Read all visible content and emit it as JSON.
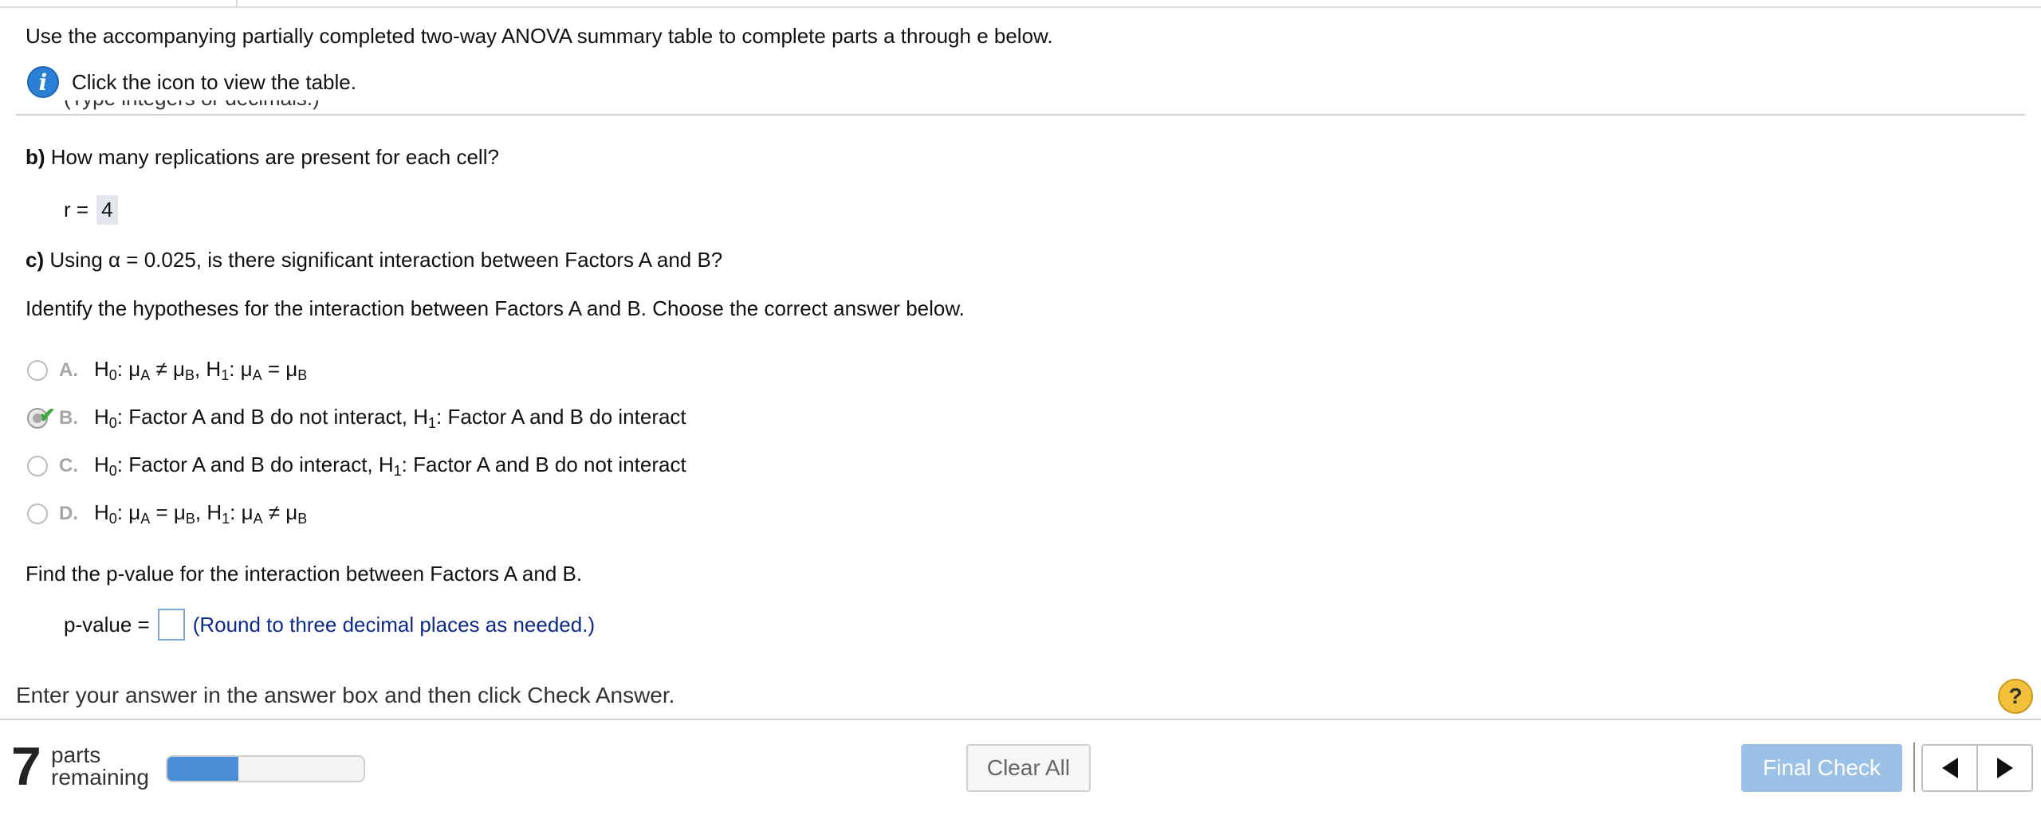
{
  "intro": "Use the accompanying partially completed two-way ANOVA summary table to complete parts a through e below.",
  "info": {
    "icon": "info-icon",
    "text": "Click the icon to view the table."
  },
  "cut_text": "(Type integers or decimals.)",
  "part_b": {
    "label": "b)",
    "question": "How many replications are present for each cell?",
    "r_label": "r =",
    "r_value": "4"
  },
  "part_c": {
    "label": "c)",
    "question": "Using α = 0.025, is there significant interaction between Factors A and B?",
    "hyp_prompt": "Identify the hypotheses for the interaction between Factors A and B. Choose the correct answer below.",
    "options": [
      {
        "letter": "A.",
        "h0": "H",
        "h0_sub": "0",
        "h0_rest": ": μ",
        "a": "A",
        "op1": " ≠ μ",
        "b": "B",
        "h1": ", H",
        "h1_sub": "1",
        "h1_rest": ": μ",
        "a2": "A",
        "op2": " = μ",
        "b2": "B"
      },
      {
        "letter": "B.",
        "selected": true,
        "h0": "H",
        "h0_sub": "0",
        "h0_text": ": Factor A and B do not interact, H",
        "h1_sub": "1",
        "h1_text": ": Factor A and B do interact"
      },
      {
        "letter": "C.",
        "h0": "H",
        "h0_sub": "0",
        "h0_text": ": Factor A and B do interact, H",
        "h1_sub": "1",
        "h1_text": ": Factor A and B do not interact"
      },
      {
        "letter": "D.",
        "h0": "H",
        "h0_sub": "0",
        "h0_rest": ": μ",
        "a": "A",
        "op1": " = μ",
        "b": "B",
        "h1": ", H",
        "h1_sub": "1",
        "h1_rest": ": μ",
        "a2": "A",
        "op2": " ≠ μ",
        "b2": "B"
      }
    ],
    "pvalue_prompt": "Find the p-value for the interaction between Factors A and B.",
    "pvalue_label": "p-value =",
    "pvalue_input": "",
    "pvalue_hint": "(Round to three decimal places as needed.)"
  },
  "instruction": "Enter your answer in the answer box and then click Check Answer.",
  "help_label": "?",
  "footer": {
    "parts_count": "7",
    "parts_label_1": "parts",
    "parts_label_2": "remaining",
    "progress_fraction": 0.36,
    "clear_label": "Clear All",
    "final_label": "Final Check",
    "prev_icon": "triangle-left-icon",
    "next_icon": "triangle-right-icon"
  },
  "colors": {
    "accent": "#2b7fd4",
    "final_button": "#9bc2e6",
    "hint": "#0d2a8a",
    "check": "#3aa73a",
    "help": "#f2c03a"
  }
}
